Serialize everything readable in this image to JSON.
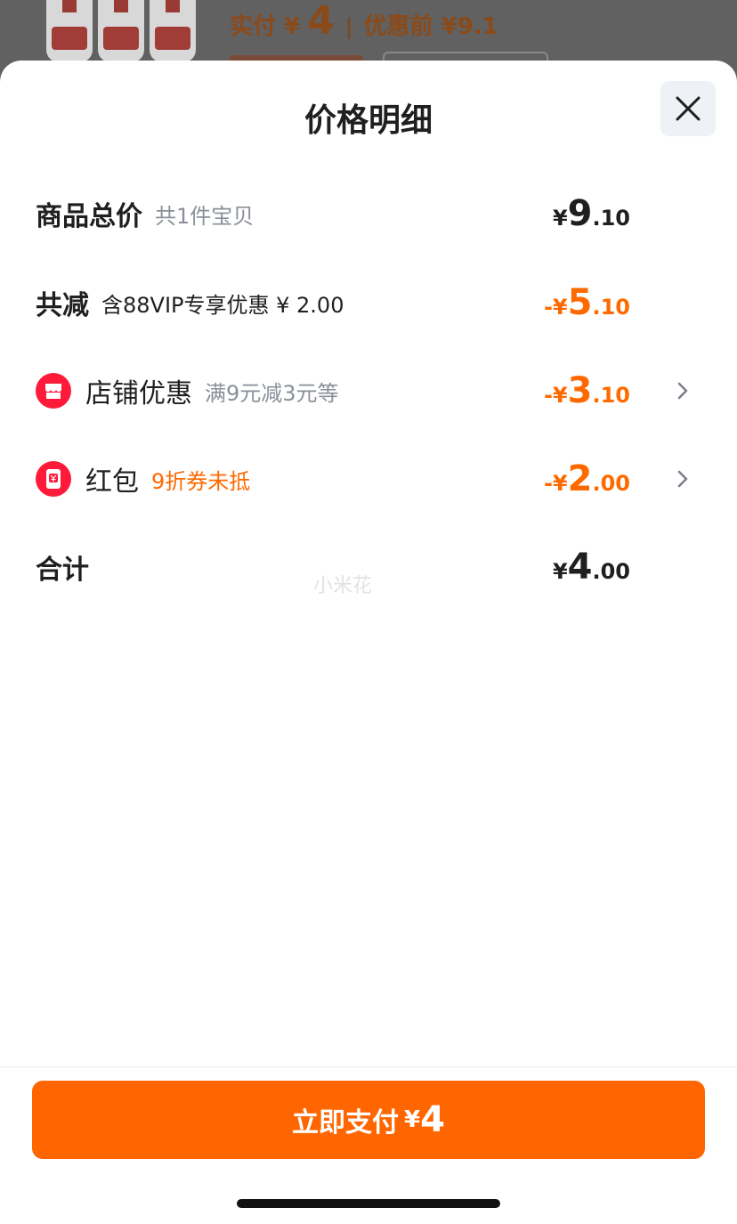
{
  "background": {
    "paid_label": "实付 ¥",
    "paid_amount": "4",
    "separator": "|",
    "original_label": "优惠前 ¥9.1"
  },
  "sheet": {
    "title": "价格明细",
    "rows": [
      {
        "label": "商品总价",
        "sub": "共1件宝贝",
        "currency": "¥",
        "int": "9",
        "dec": ".10"
      },
      {
        "label": "共减",
        "sub": "含88VIP专享优惠 ¥ 2.00",
        "currency": "-¥",
        "int": "5",
        "dec": ".10"
      },
      {
        "label": "店铺优惠",
        "sub": "满9元减3元等",
        "currency": "-¥",
        "int": "3",
        "dec": ".10"
      },
      {
        "label": "红包",
        "sub": "9折券未抵",
        "currency": "-¥",
        "int": "2",
        "dec": ".00"
      },
      {
        "label": "合计",
        "currency": "¥",
        "int": "4",
        "dec": ".00"
      }
    ],
    "watermark": "小米花"
  },
  "footer": {
    "pay_label": "立即支付",
    "currency": "¥",
    "amount": "4"
  },
  "colors": {
    "accent": "#ff6600",
    "coupon_red": "#ff1a3a"
  },
  "icons": [
    "close-icon",
    "shop-icon",
    "red-packet-icon",
    "chevron-right-icon"
  ]
}
